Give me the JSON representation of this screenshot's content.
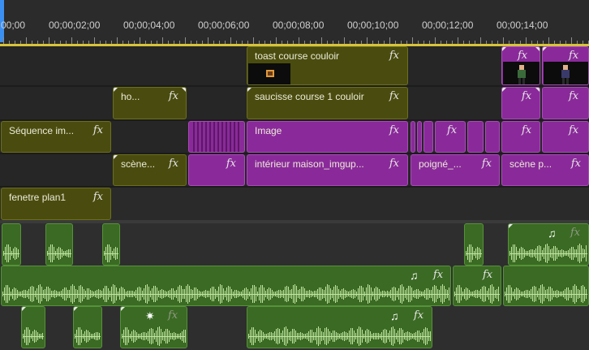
{
  "ruler": {
    "labels": [
      "00;00",
      "00;00;02;00",
      "00;00;04;00",
      "00;00;06;00",
      "00;00;08;00",
      "00;00;10;00",
      "00;00;12;00",
      "00;00;14;00"
    ]
  },
  "colors": {
    "background": "#232323",
    "video_clip_olive": "#4a4c0f",
    "video_clip_purple": "#8a2a9a",
    "audio_clip_green": "#3b6a24",
    "work_area": "#d8c33a",
    "playhead": "#3b8ff0"
  },
  "icons": {
    "effects": "fx",
    "music_note": "♫",
    "burst": "✷"
  },
  "video_tracks": {
    "v5": {
      "clips": [
        {
          "label": "toast course couloir"
        }
      ]
    },
    "v4": {
      "clips": [
        {
          "label": "ho..."
        },
        {
          "label": "saucisse course 1 couloir"
        }
      ]
    },
    "v3": {
      "clips": [
        {
          "label": "Séquence im..."
        },
        {
          "label": "Image"
        }
      ]
    },
    "v2": {
      "clips": [
        {
          "label": "scène..."
        },
        {
          "label": "intérieur maison_imgup..."
        },
        {
          "label": "poigné_..."
        },
        {
          "label": "scène p..."
        }
      ]
    },
    "v1": {
      "clips": [
        {
          "label": "fenetre plan1"
        }
      ]
    }
  }
}
